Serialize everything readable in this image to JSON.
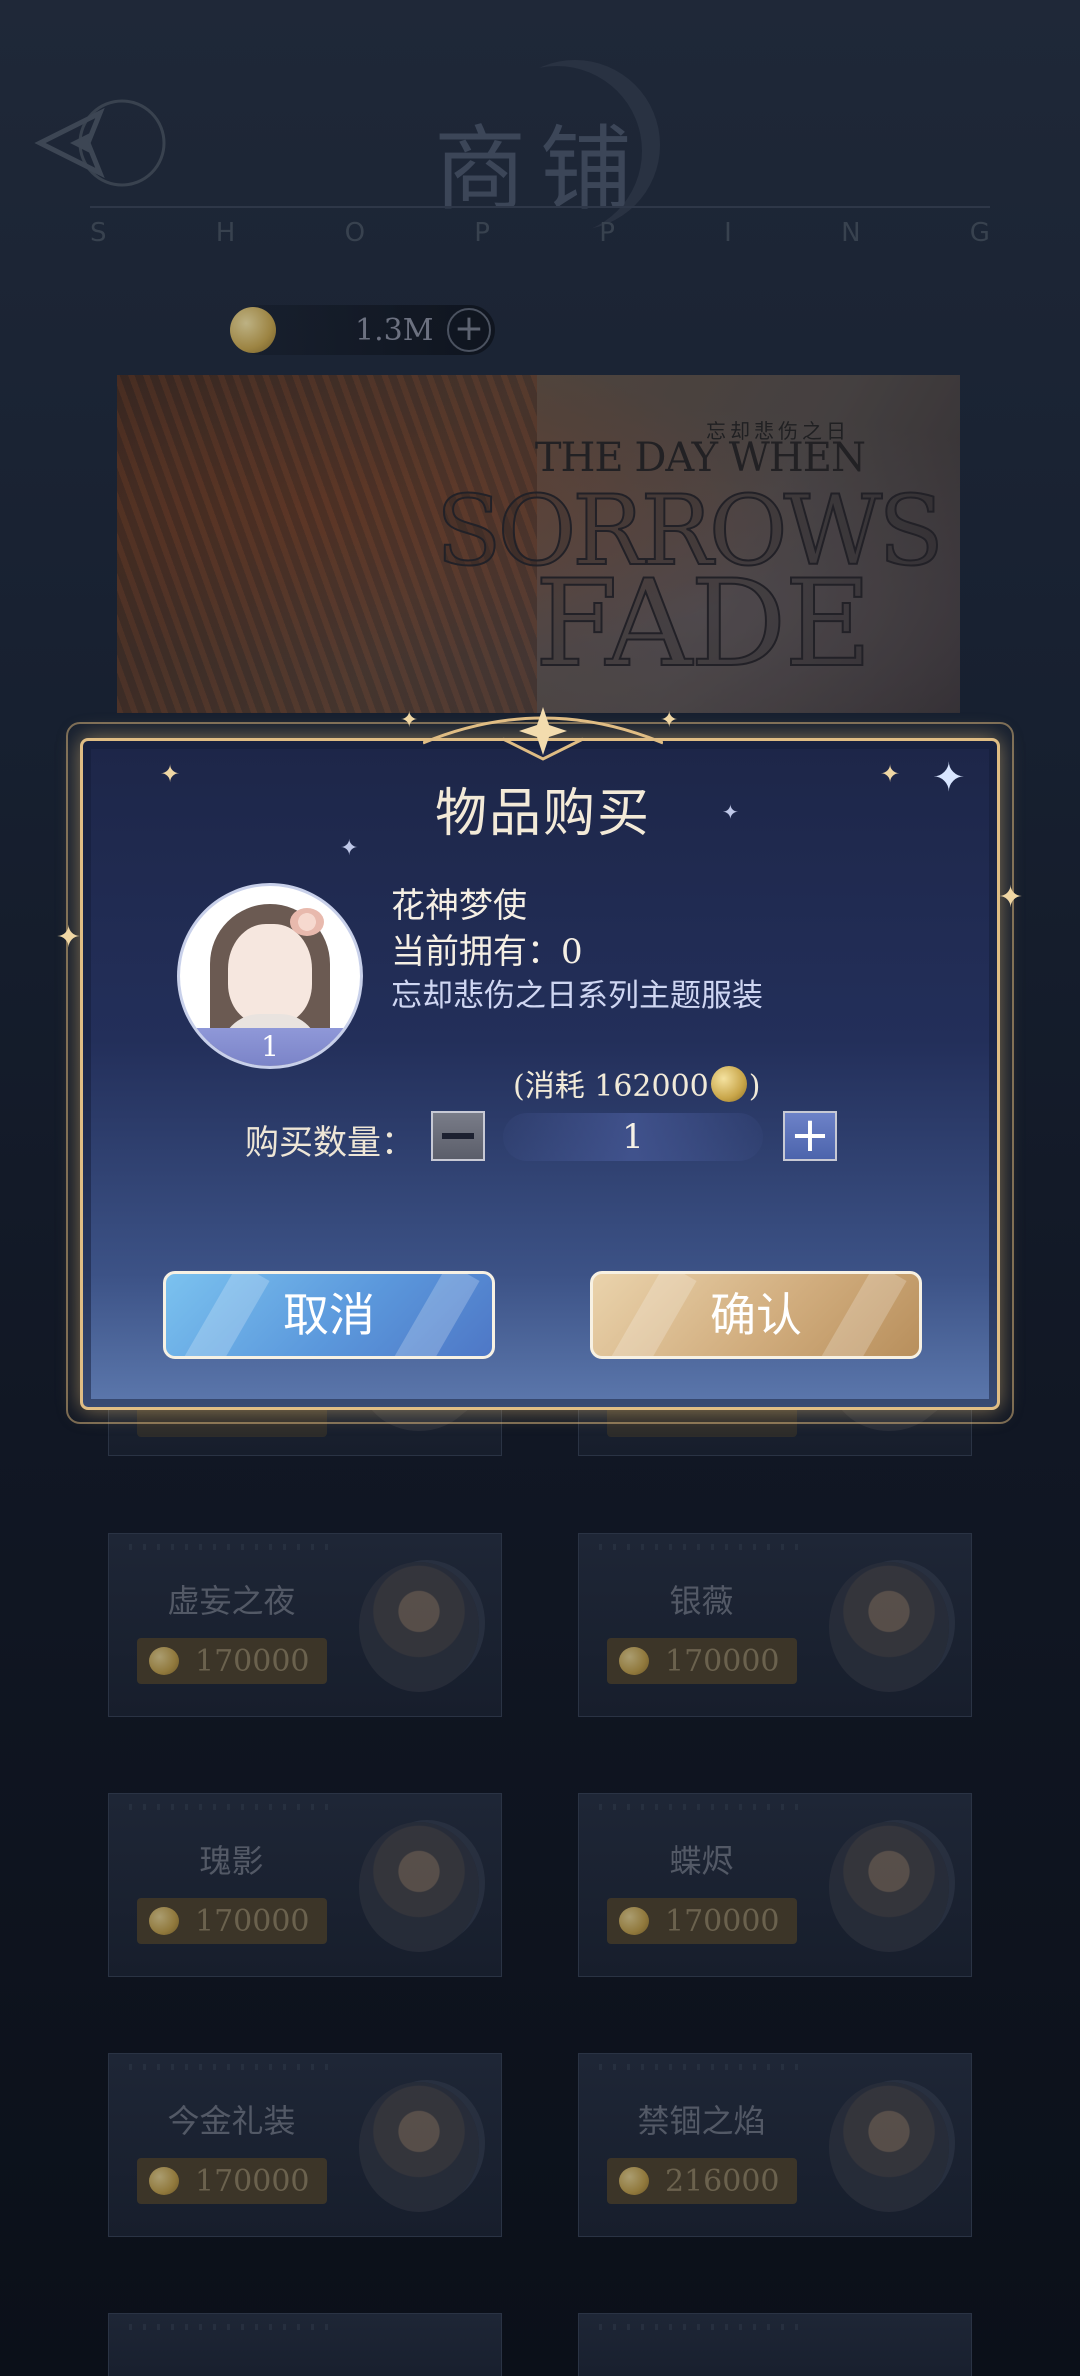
{
  "header": {
    "title": "商铺",
    "subtitle_letters": [
      "S",
      "H",
      "O",
      "P",
      "P",
      "I",
      "N",
      "G"
    ]
  },
  "currency": {
    "amount": "1.3M",
    "add_label": "+"
  },
  "banner": {
    "subtitle": "忘却悲伤之日",
    "line1": "THE DAY WHEN",
    "line2": "SORROWS",
    "line3": "FADE"
  },
  "shop_items": [
    {
      "name": "虚妄之夜",
      "price": "170000"
    },
    {
      "name": "银薇",
      "price": "170000"
    },
    {
      "name": "瑰影",
      "price": "170000"
    },
    {
      "name": "蝶烬",
      "price": "170000"
    },
    {
      "name": "今金礼装",
      "price": "170000"
    },
    {
      "name": "禁锢之焰",
      "price": "216000"
    }
  ],
  "dialog": {
    "title": "物品购买",
    "item_name": "花神梦使",
    "owned_text": "当前拥有：0",
    "description": "忘却悲伤之日系列主题服装",
    "avatar_count": "1",
    "cost_prefix": "(消耗 162000",
    "cost_suffix": ")",
    "quantity_label": "购买数量：",
    "quantity_value": "1",
    "plus_label": "+",
    "cancel_label": "取消",
    "confirm_label": "确认"
  },
  "colors": {
    "accent_gold": "#e0bd84",
    "cancel_blue": "#5b98dc",
    "confirm_gold": "#d1ad7e",
    "dialog_bg": "#232f5a"
  }
}
